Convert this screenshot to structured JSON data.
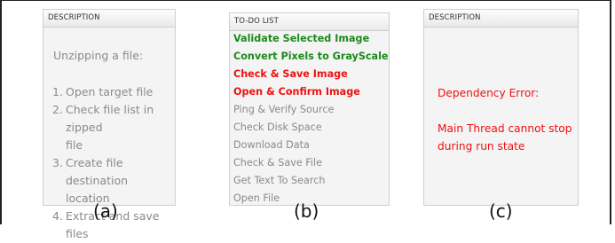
{
  "panel_a": {
    "header": "DESCRIPTION",
    "title": "Unzipping a file:",
    "steps": [
      {
        "num": "1.",
        "lines": [
          "Open target file"
        ]
      },
      {
        "num": "2.",
        "lines": [
          "Check file list in zipped",
          "file"
        ]
      },
      {
        "num": "3.",
        "lines": [
          "Create file destination",
          "location"
        ]
      },
      {
        "num": "4.",
        "lines": [
          "Extract and save files"
        ]
      }
    ],
    "caption": "(a)"
  },
  "panel_b": {
    "header": "TO-DO LIST",
    "items": [
      {
        "label": "Validate Selected Image",
        "status": "done"
      },
      {
        "label": "Convert Pixels to GrayScale",
        "status": "done"
      },
      {
        "label": "Check & Save Image",
        "status": "error"
      },
      {
        "label": "Open & Confirm Image",
        "status": "error"
      },
      {
        "label": "Ping & Verify Source",
        "status": "pending"
      },
      {
        "label": "Check Disk Space",
        "status": "pending"
      },
      {
        "label": "Download Data",
        "status": "pending"
      },
      {
        "label": "Check & Save File",
        "status": "pending"
      },
      {
        "label": "Get Text To Search",
        "status": "pending"
      },
      {
        "label": "Open File",
        "status": "pending"
      }
    ],
    "caption": "(b)"
  },
  "panel_c": {
    "header": "DESCRIPTION",
    "error_title": "Dependency Error:",
    "error_message_lines": [
      "Main Thread cannot stop",
      "during run state"
    ],
    "caption": "(c)"
  },
  "colors": {
    "done": "#1b8a1b",
    "error": "#ee1111",
    "pending": "#8a8a8a"
  }
}
